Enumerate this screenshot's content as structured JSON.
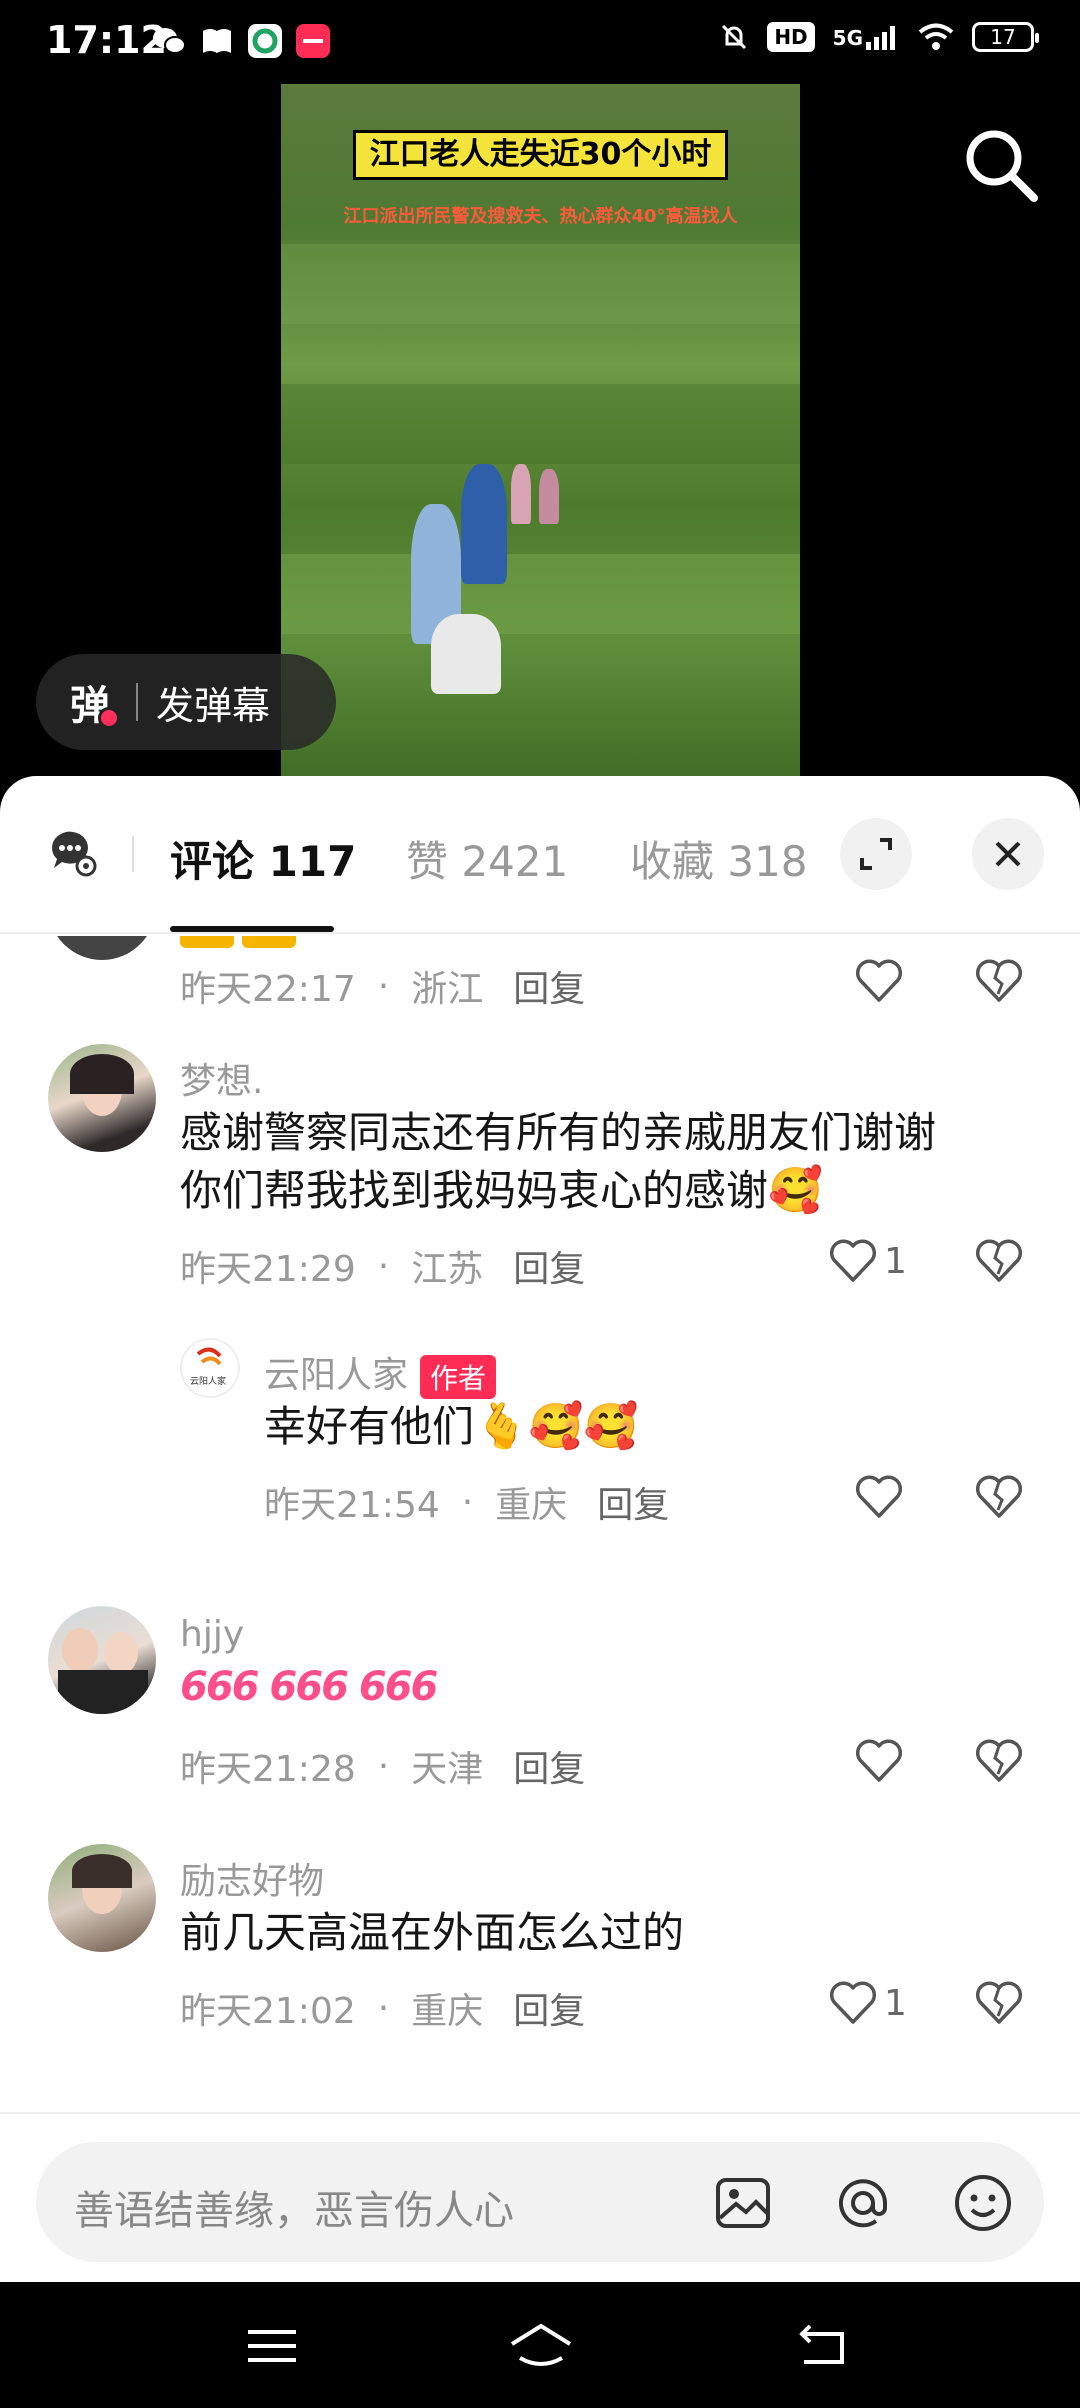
{
  "status_bar": {
    "time": "17:12",
    "hd": "HD",
    "network": "5G",
    "battery": "17",
    "icons": [
      "wechat-icon",
      "book-icon",
      "green-app-icon",
      "red-app-icon",
      "mute-icon",
      "signal-icon",
      "wifi-icon"
    ]
  },
  "video": {
    "title": "江口老人走失近30个小时",
    "subtitle": "江口派出所民警及搜救夫、热心群众40°高温找人",
    "danmu_icon": "弹",
    "danmu_label": "发弹幕"
  },
  "tabs": {
    "comments_label": "评论 117",
    "likes_label": "赞 2421",
    "favorites_label": "收藏 318"
  },
  "comments": [
    {
      "time": "昨天22:17",
      "location": "浙江",
      "reply": "回复",
      "likes": ""
    },
    {
      "user": "梦想.",
      "text_line1": "感谢警察同志还有所有的亲戚朋友们谢谢",
      "text_line2": "你们帮我找到我妈妈衷心的感谢",
      "emoji": "🥰",
      "time": "昨天21:29",
      "location": "江苏",
      "reply": "回复",
      "likes": "1"
    },
    {
      "user": "云阳人家",
      "badge": "作者",
      "avatar_text": "云阳人家",
      "text": "幸好有他们",
      "emoji": "🫰🥰🥰",
      "time": "昨天21:54",
      "location": "重庆",
      "reply": "回复",
      "likes": ""
    },
    {
      "user": "hjjy",
      "text": "666 666 666",
      "time": "昨天21:28",
      "location": "天津",
      "reply": "回复",
      "likes": ""
    },
    {
      "user": "励志好物",
      "text": "前几天高温在外面怎么过的",
      "time": "昨天21:02",
      "location": "重庆",
      "reply": "回复",
      "likes": "1"
    }
  ],
  "input": {
    "placeholder": "善语结善缘，恶言伤人心"
  },
  "colors": {
    "accent": "#ff2d55",
    "text": "#161616",
    "muted": "#999999"
  }
}
